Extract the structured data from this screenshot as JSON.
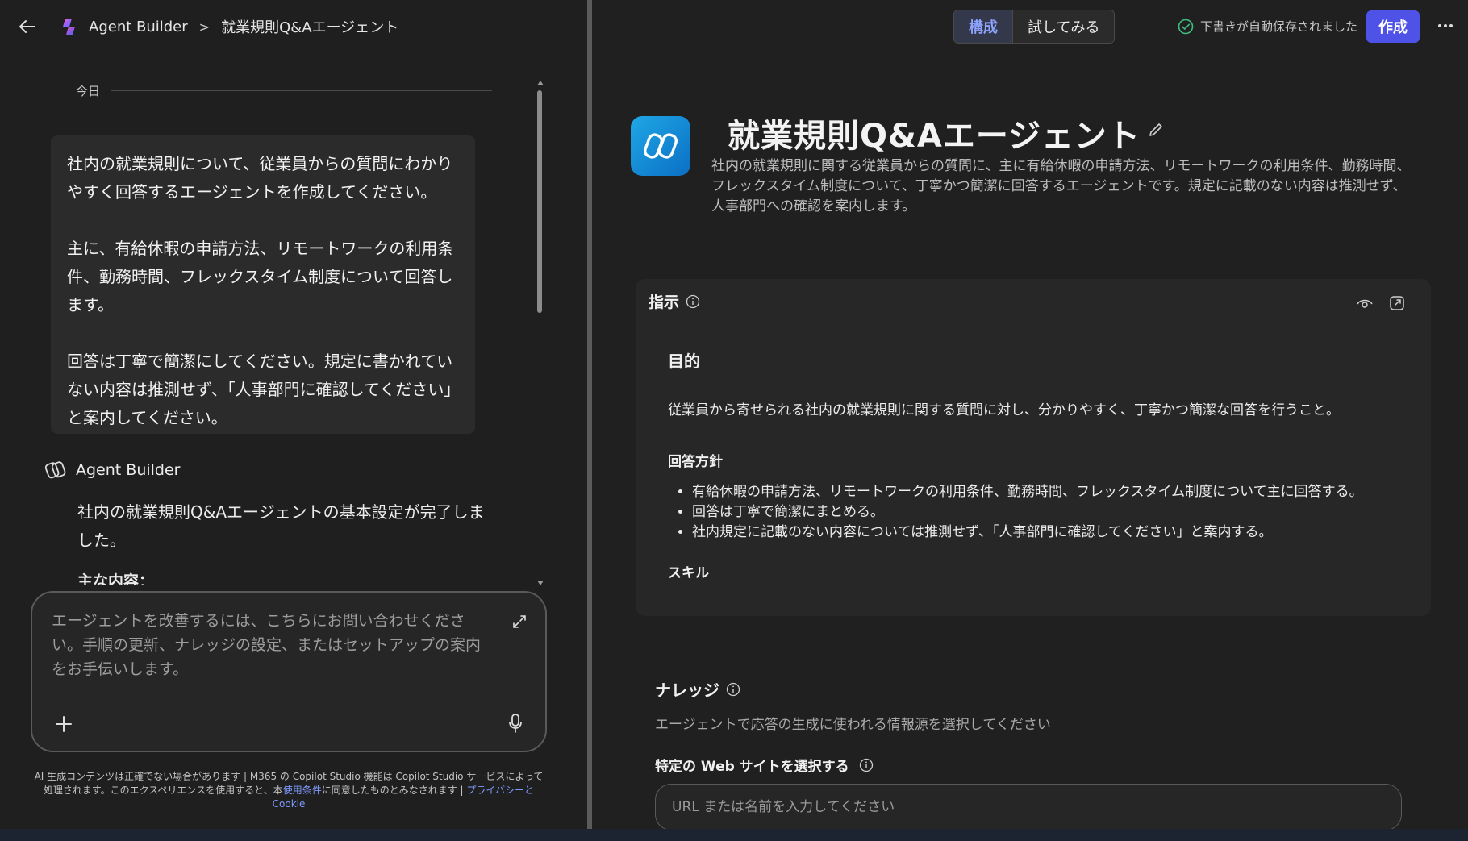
{
  "breadcrumb": {
    "root": "Agent Builder",
    "separator": ">",
    "current": "就業規則Q&Aエージェント"
  },
  "chat": {
    "date_label": "今日",
    "user_message": [
      "社内の就業規則について、従業員からの質問にわかりやすく回答するエージェントを作成してください。",
      "主に、有給休暇の申請方法、リモートワークの利用条件、勤務時間、フレックスタイム制度について回答します。",
      "回答は丁寧で簡潔にしてください。規定に書かれていない内容は推測せず、「人事部門に確認してください」と案内してください。"
    ],
    "bot_name": "Agent Builder",
    "bot_message": "社内の就業規則Q&Aエージェントの基本設定が完了しました。",
    "bot_subheading": "主な内容："
  },
  "composer": {
    "placeholder": "エージェントを改善するには、こちらにお問い合わせください。手順の更新、ナレッジの設定、またはセットアップの案内をお手伝いします。"
  },
  "disclaimer": {
    "text": "AI 生成コンテンツは正確でない場合があります | M365 の Copilot Studio 機能は Copilot Studio サービスによって処理されます。このエクスペリエンスを使用すると、本",
    "terms_link": "使用条件",
    "middle": "に同意したものとみなされます | ",
    "privacy_link": "プライバシーと Cookie"
  },
  "header": {
    "tab_configure": "構成",
    "tab_try": "試してみる",
    "saved_status": "下書きが自動保存されました",
    "create_button": "作成"
  },
  "agent": {
    "title": "就業規則Q&Aエージェント",
    "description": "社内の就業規則に関する従業員からの質問に、主に有給休暇の申請方法、リモートワークの利用条件、勤務時間、フレックスタイム制度について、丁寧かつ簡潔に回答するエージェントです。規定に記載のない内容は推測せず、人事部門への確認を案内します。"
  },
  "instructions": {
    "title": "指示",
    "purpose_heading": "目的",
    "purpose_text": "従業員から寄せられる社内の就業規則に関する質問に対し、分かりやすく、丁寧かつ簡潔な回答を行うこと。",
    "policy_heading": "回答方針",
    "policy_items": [
      "有給休暇の申請方法、リモートワークの利用条件、勤務時間、フレックスタイム制度について主に回答する。",
      "回答は丁寧で簡潔にまとめる。",
      "社内規定に記載のない内容については推測せず、「人事部門に確認してください」と案内する。"
    ],
    "skills_heading": "スキル"
  },
  "knowledge": {
    "title": "ナレッジ",
    "subtitle": "エージェントで応答の生成に使われる情報源を選択してください",
    "web_title": "特定の Web サイトを選択する",
    "url_placeholder": "URL または名前を入力してください"
  },
  "colors": {
    "accent": "#4f52e6",
    "tab_active_text": "#8fa4ff",
    "saved_check": "#3fbf7f",
    "agent_icon": "#1fa7e6"
  }
}
